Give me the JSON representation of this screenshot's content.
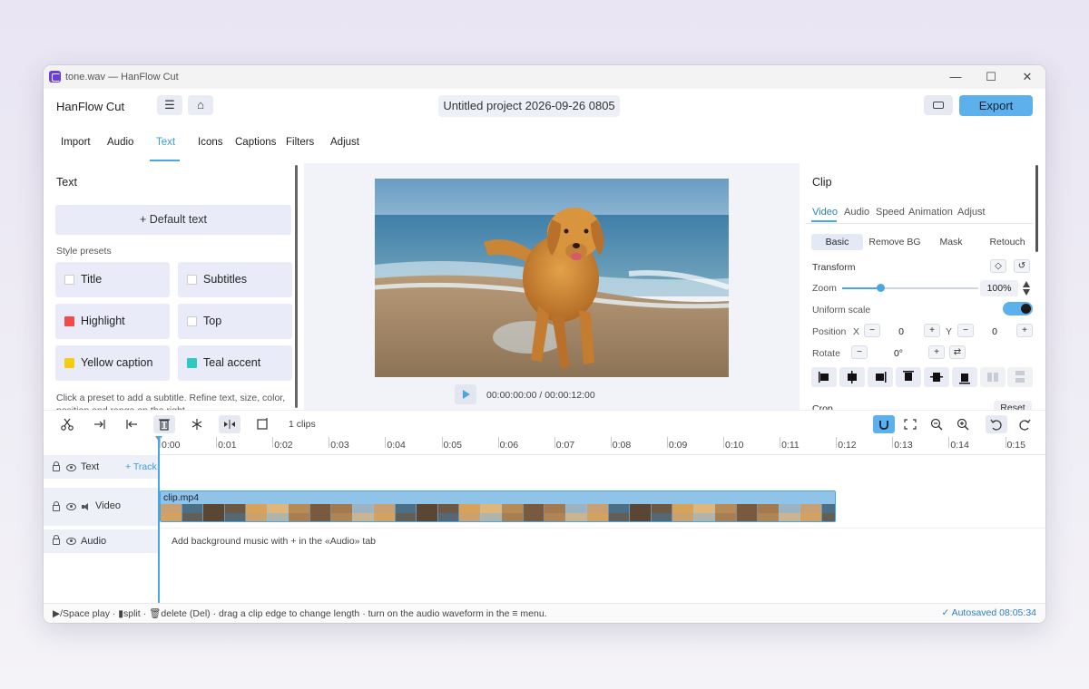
{
  "window": {
    "title": "tone.wav — HanFlow Cut",
    "controls": {
      "minimize": "—",
      "maximize": "☐",
      "close": "✕"
    }
  },
  "header": {
    "app_name": "HanFlow Cut",
    "menu_icon": "☰",
    "home_icon": "⌂",
    "project_title": "Untitled project 2026-09-26 0805",
    "export_label": "Export"
  },
  "tabs": [
    {
      "label": "Import"
    },
    {
      "label": "Audio"
    },
    {
      "label": "Text",
      "active": true
    },
    {
      "label": "Icons"
    },
    {
      "label": "Captions"
    },
    {
      "label": "Filters"
    },
    {
      "label": "Adjust"
    }
  ],
  "left_panel": {
    "heading": "Text",
    "default_text_btn": "+ Default text",
    "style_presets_label": "Style presets",
    "presets": [
      {
        "label": "Title",
        "color": "#ffffff"
      },
      {
        "label": "Subtitles",
        "color": "#ffffff"
      },
      {
        "label": "Highlight",
        "color": "#f04b4b"
      },
      {
        "label": "Top",
        "color": "#ffffff"
      },
      {
        "label": "Yellow caption",
        "color": "#f5cc12"
      },
      {
        "label": "Teal accent",
        "color": "#2fc9c2"
      }
    ],
    "hint": "Click a preset to add a subtitle. Refine text, size, color, position and range on the right."
  },
  "preview": {
    "timecode": "00:00:00:00 / 00:00:12:00"
  },
  "right_panel": {
    "heading": "Clip",
    "tabs": [
      {
        "label": "Video",
        "active": true
      },
      {
        "label": "Audio"
      },
      {
        "label": "Speed"
      },
      {
        "label": "Animation"
      },
      {
        "label": "Adjust"
      }
    ],
    "sub_tabs": [
      {
        "label": "Basic",
        "active": true
      },
      {
        "label": "Remove BG"
      },
      {
        "label": "Mask"
      },
      {
        "label": "Retouch"
      }
    ],
    "transform_label": "Transform",
    "keyframe_icon": "◇",
    "reset_icon": "↺",
    "zoom_label": "Zoom",
    "zoom_value": "100%",
    "zoom_fraction": 0.28,
    "uniform_scale_label": "Uniform scale",
    "uniform_scale_on": true,
    "position_label": "Position",
    "x_label": "X",
    "y_label": "Y",
    "x_value": "0",
    "y_value": "0",
    "minus": "−",
    "plus": "+",
    "rotate_label": "Rotate",
    "rotate_value": "0°",
    "flip_icon": "⇄",
    "crop_label": "Crop",
    "reset_label": "Reset"
  },
  "toolbar": {
    "clips_count": "1 clips"
  },
  "timeline": {
    "ticks": [
      "0:00",
      "0:01",
      "0:02",
      "0:03",
      "0:04",
      "0:05",
      "0:06",
      "0:07",
      "0:08",
      "0:09",
      "0:10",
      "0:11",
      "0:12",
      "0:13",
      "0:14",
      "0:15"
    ],
    "tracks": [
      {
        "name": "Text",
        "add": "+ Track"
      },
      {
        "name": "Video"
      },
      {
        "name": "Audio"
      }
    ],
    "clip_name": "clip.mp4",
    "audio_hint": "Add background music with + in the «Audio» tab"
  },
  "status": {
    "left": "▶/Space play · ▮split · 🗑delete (Del) · drag a clip edge to change length · turn on the audio waveform in the ≡ menu.",
    "right": "✓ Autosaved 08:05:34"
  }
}
